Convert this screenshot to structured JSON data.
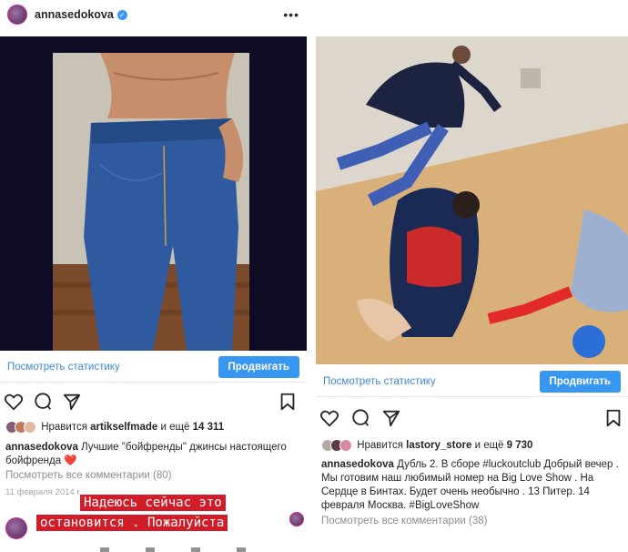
{
  "left": {
    "username": "annasedokova",
    "stats_link": "Посмотреть статистику",
    "promote_label": "Продвигать",
    "likes": {
      "prefix": "Нравится ",
      "user": "artikselfmade",
      "mid": " и ещё ",
      "count": "14 311"
    },
    "caption": {
      "user": "annasedokova",
      "text": " Лучшие \"бойфренды\" джинсы настоящего бойфренда ❤️"
    },
    "comments_link": "Посмотреть все комментарии (80)",
    "date": "11 февраля 2014 г.",
    "story_text": {
      "line1": "Надеюсь сейчас это",
      "line2": "остановится . Пожалуйста"
    }
  },
  "right": {
    "stats_link": "Посмотреть статистику",
    "promote_label": "Продвигать",
    "likes": {
      "prefix": "Нравится ",
      "user": "lastory_store",
      "mid": " и ещё ",
      "count": "9 730"
    },
    "caption": {
      "user": "annasedokova",
      "text": " Дубль 2. В сборе  #luckoutclub Добрый вечер . Мы готовим наш любимый номер на Big Love Show . На Сердце в Бинтах. Будет очень необычно . 13 Питер. 14 февраля Москва. #BigLoveShow"
    },
    "comments_link": "Посмотреть все комментарии (38)"
  },
  "colors": {
    "accent": "#3897f0",
    "story_bg": "#d11d2a",
    "heart": "#e0245e"
  },
  "icons": [
    "heart-icon",
    "comment-icon",
    "share-icon",
    "bookmark-icon",
    "verified-icon",
    "more-icon"
  ]
}
